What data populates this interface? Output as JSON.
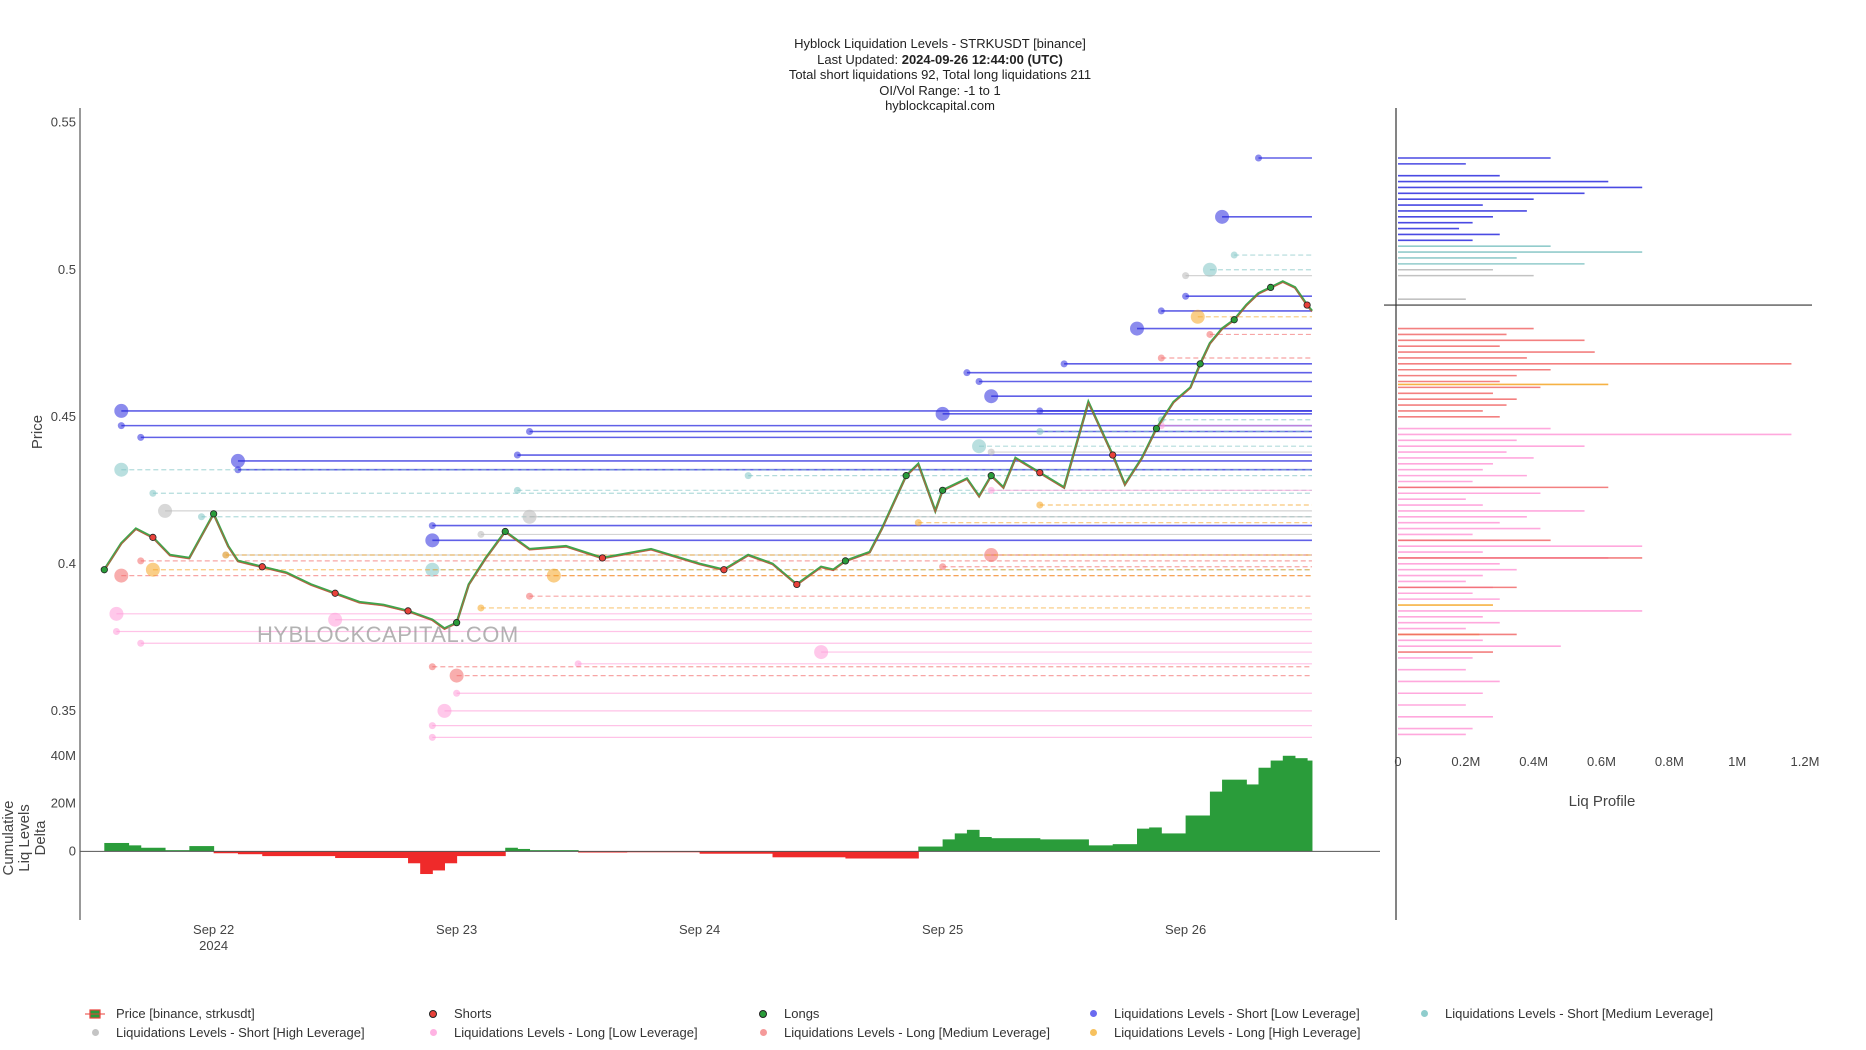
{
  "title": {
    "line1": "Hyblock Liquidation Levels - STRKUSDT [binance]",
    "line2_label": "Last Updated:",
    "line2_value": "2024-09-26 12:44:00 (UTC)",
    "line3": "Total short liquidations 92, Total long liquidations 211",
    "line4": "OI/Vol Range: -1 to 1",
    "line5": "hyblockcapital.com"
  },
  "watermark": "HYBLOCKCAPITAL.COM",
  "colors": {
    "price_up": "#2a9c3a",
    "price_down": "#e8413a",
    "short_low": "#2b2bdf",
    "short_medium": "#7fc4c4",
    "short_high": "#b8b8b8",
    "long_low": "#ff9ad8",
    "long_medium": "#f26a6a",
    "long_high": "#f5a524",
    "delta_pos": "#2a9c3a",
    "delta_neg": "#ef2a2a",
    "axis": "#333333"
  },
  "chart_data": [
    {
      "type": "line",
      "panel": "price",
      "ylabel": "Price",
      "ylim": [
        0.335,
        0.555
      ],
      "yticks": [
        "0.55",
        "0.5",
        "0.45",
        "0.4",
        "0.35"
      ],
      "ytick_values": [
        0.55,
        0.5,
        0.45,
        0.4,
        0.35
      ],
      "xticks": [
        "Sep 22\n2024",
        "Sep 23",
        "Sep 24",
        "Sep 25",
        "Sep 26"
      ],
      "xtick_days": [
        22,
        23,
        24,
        25,
        26
      ],
      "xrange_days": [
        21.45,
        26.8
      ],
      "series": [
        {
          "name": "Price [binance, strkusdt]",
          "x_days": [
            21.55,
            21.62,
            21.68,
            21.75,
            21.82,
            21.9,
            22.0,
            22.06,
            22.1,
            22.2,
            22.3,
            22.4,
            22.5,
            22.6,
            22.7,
            22.8,
            22.9,
            22.95,
            23.0,
            23.05,
            23.12,
            23.2,
            23.3,
            23.45,
            23.6,
            23.8,
            24.0,
            24.1,
            24.2,
            24.3,
            24.4,
            24.5,
            24.55,
            24.6,
            24.7,
            24.75,
            24.85,
            24.9,
            24.97,
            25.0,
            25.1,
            25.15,
            25.2,
            25.25,
            25.3,
            25.4,
            25.5,
            25.6,
            25.7,
            25.75,
            25.82,
            25.88,
            25.95,
            26.02,
            26.06,
            26.1,
            26.15,
            26.2,
            26.25,
            26.3,
            26.35,
            26.4,
            26.45,
            26.5,
            26.52
          ],
          "values": [
            0.398,
            0.407,
            0.412,
            0.409,
            0.403,
            0.402,
            0.417,
            0.406,
            0.401,
            0.399,
            0.397,
            0.393,
            0.39,
            0.387,
            0.386,
            0.384,
            0.381,
            0.378,
            0.38,
            0.393,
            0.402,
            0.411,
            0.405,
            0.406,
            0.402,
            0.405,
            0.4,
            0.398,
            0.403,
            0.4,
            0.393,
            0.399,
            0.398,
            0.401,
            0.404,
            0.412,
            0.43,
            0.434,
            0.418,
            0.425,
            0.429,
            0.423,
            0.43,
            0.426,
            0.436,
            0.431,
            0.426,
            0.455,
            0.437,
            0.427,
            0.436,
            0.446,
            0.455,
            0.46,
            0.468,
            0.475,
            0.48,
            0.483,
            0.488,
            0.492,
            0.494,
            0.496,
            0.494,
            0.488,
            0.486
          ]
        }
      ]
    },
    {
      "type": "bar",
      "panel": "liq-levels",
      "series": [
        {
          "name": "Liquidations Levels - Short [Low Leverage]",
          "start_days": [
            21.62,
            21.62,
            21.7,
            22.1,
            22.1,
            22.9,
            22.9,
            23.25,
            23.3,
            25.0,
            25.1,
            25.15,
            25.2,
            25.4,
            25.5,
            25.8,
            25.9,
            26.0,
            26.15,
            26.3
          ],
          "values": [
            0.452,
            0.447,
            0.443,
            0.435,
            0.432,
            0.413,
            0.408,
            0.437,
            0.445,
            0.451,
            0.465,
            0.462,
            0.457,
            0.452,
            0.468,
            0.48,
            0.486,
            0.491,
            0.518,
            0.538
          ]
        },
        {
          "name": "Liquidations Levels - Short [Medium Leverage]",
          "start_days": [
            21.62,
            21.75,
            21.95,
            22.9,
            23.25,
            24.2,
            25.15,
            25.4,
            25.9,
            26.1,
            26.2
          ],
          "values": [
            0.432,
            0.424,
            0.416,
            0.398,
            0.425,
            0.43,
            0.44,
            0.445,
            0.449,
            0.5,
            0.505
          ]
        },
        {
          "name": "Liquidations Levels - Short [High Leverage]",
          "start_days": [
            21.8,
            22.05,
            23.1,
            23.3,
            25.2,
            26.0
          ],
          "values": [
            0.418,
            0.403,
            0.41,
            0.416,
            0.438,
            0.498
          ]
        },
        {
          "name": "Liquidations Levels - Long [Low Leverage]",
          "start_days": [
            21.6,
            21.6,
            21.7,
            22.5,
            22.9,
            22.9,
            22.95,
            23.0,
            23.5,
            24.5,
            25.2,
            25.9
          ],
          "values": [
            0.383,
            0.377,
            0.373,
            0.381,
            0.341,
            0.345,
            0.35,
            0.356,
            0.366,
            0.37,
            0.425,
            0.447
          ]
        },
        {
          "name": "Liquidations Levels - Long [Medium Leverage]",
          "start_days": [
            21.62,
            21.7,
            22.9,
            23.0,
            23.3,
            25.0,
            25.2,
            25.9,
            26.1
          ],
          "values": [
            0.396,
            0.401,
            0.365,
            0.362,
            0.389,
            0.399,
            0.403,
            0.47,
            0.478
          ]
        },
        {
          "name": "Liquidations Levels - Long [High Leverage]",
          "start_days": [
            21.75,
            22.05,
            23.1,
            23.4,
            24.9,
            25.4,
            26.05
          ],
          "values": [
            0.398,
            0.403,
            0.385,
            0.396,
            0.414,
            0.42,
            0.484
          ]
        }
      ]
    },
    {
      "type": "area",
      "panel": "delta",
      "ylabel": "Cumulative Liq Levels Delta",
      "ylim": [
        -12,
        42
      ],
      "yticks": [
        "40M",
        "20M",
        "0"
      ],
      "ytick_values": [
        40,
        20,
        0
      ],
      "x_days": [
        21.55,
        21.65,
        21.7,
        21.8,
        21.9,
        22.0,
        22.1,
        22.2,
        22.5,
        22.8,
        22.85,
        22.9,
        22.95,
        23.0,
        23.2,
        23.25,
        23.3,
        23.5,
        23.7,
        24.0,
        24.3,
        24.6,
        24.9,
        25.0,
        25.05,
        25.1,
        25.15,
        25.2,
        25.4,
        25.6,
        25.7,
        25.8,
        25.85,
        25.9,
        26.0,
        26.1,
        26.15,
        26.25,
        26.3,
        26.35,
        26.4,
        26.45,
        26.5,
        26.52
      ],
      "values": [
        0,
        3.5,
        2.5,
        1.5,
        0.5,
        2.2,
        -0.8,
        -1.2,
        -2.0,
        -2.8,
        -5.0,
        -9.5,
        -8.0,
        -5.0,
        -2.0,
        1.5,
        1.0,
        0.5,
        -0.5,
        -0.4,
        -1.0,
        -2.5,
        -3.0,
        2.0,
        5.0,
        7.5,
        9.0,
        6.0,
        5.5,
        5.0,
        2.5,
        3.0,
        9.5,
        10.0,
        7.5,
        15.0,
        25.0,
        30.0,
        28.0,
        35.0,
        38.0,
        40.0,
        39.0,
        38.0
      ]
    },
    {
      "type": "bar",
      "panel": "liq-profile",
      "xlabel": "Liq Profile",
      "xlim": [
        0,
        1.2
      ],
      "xticks": [
        "0",
        "0.2M",
        "0.4M",
        "0.6M",
        "0.8M",
        "1M",
        "1.2M"
      ],
      "xtick_values": [
        0,
        0.2,
        0.4,
        0.6,
        0.8,
        1.0,
        1.2
      ],
      "current_price": 0.488,
      "series": [
        {
          "name": "short-low",
          "price": [
            0.538,
            0.536,
            0.532,
            0.53,
            0.528,
            0.526,
            0.524,
            0.522,
            0.52,
            0.518,
            0.516,
            0.514,
            0.512,
            0.51
          ],
          "values": [
            0.45,
            0.2,
            0.3,
            0.62,
            0.72,
            0.55,
            0.4,
            0.25,
            0.38,
            0.28,
            0.22,
            0.18,
            0.3,
            0.22
          ]
        },
        {
          "name": "short-medium",
          "price": [
            0.508,
            0.506,
            0.504,
            0.502
          ],
          "values": [
            0.45,
            0.72,
            0.35,
            0.55
          ]
        },
        {
          "name": "short-high",
          "price": [
            0.5,
            0.498,
            0.49
          ],
          "values": [
            0.28,
            0.4,
            0.2
          ]
        },
        {
          "name": "long-medium",
          "price": [
            0.48,
            0.478,
            0.476,
            0.474,
            0.472,
            0.47,
            0.468,
            0.466,
            0.464,
            0.462,
            0.46,
            0.458,
            0.456,
            0.454,
            0.452,
            0.45
          ],
          "values": [
            0.4,
            0.32,
            0.55,
            0.3,
            0.58,
            0.38,
            1.16,
            0.45,
            0.35,
            0.3,
            0.42,
            0.28,
            0.35,
            0.32,
            0.25,
            0.3
          ]
        },
        {
          "name": "long-high",
          "price": [
            0.461,
            0.386,
            0.376
          ],
          "values": [
            0.62,
            0.28,
            0.24
          ]
        },
        {
          "name": "long-low",
          "price": [
            0.446,
            0.444,
            0.442,
            0.44,
            0.438,
            0.436,
            0.434,
            0.432,
            0.43,
            0.428,
            0.426,
            0.424,
            0.422,
            0.42,
            0.418,
            0.416,
            0.414,
            0.412,
            0.41,
            0.408,
            0.406,
            0.404,
            0.402,
            0.4,
            0.398,
            0.396,
            0.394,
            0.392,
            0.39,
            0.388,
            0.384,
            0.382,
            0.38,
            0.378,
            0.374,
            0.372,
            0.368,
            0.364,
            0.36,
            0.356,
            0.352,
            0.348,
            0.344,
            0.342
          ],
          "values": [
            0.45,
            1.16,
            0.35,
            0.55,
            0.32,
            0.4,
            0.28,
            0.25,
            0.38,
            0.22,
            0.3,
            0.42,
            0.2,
            0.25,
            0.55,
            0.38,
            0.3,
            0.42,
            0.22,
            0.3,
            0.72,
            0.25,
            0.62,
            0.3,
            0.35,
            0.25,
            0.2,
            0.28,
            0.22,
            0.3,
            0.72,
            0.25,
            0.3,
            0.2,
            0.25,
            0.48,
            0.22,
            0.2,
            0.3,
            0.25,
            0.2,
            0.28,
            0.22,
            0.2
          ]
        },
        {
          "name": "long-medium-lower",
          "price": [
            0.426,
            0.408,
            0.402,
            0.392,
            0.376,
            0.37
          ],
          "values": [
            0.62,
            0.45,
            0.72,
            0.35,
            0.35,
            0.28
          ]
        }
      ]
    }
  ],
  "legend": [
    {
      "label": "Price [binance, strkusdt]",
      "kind": "candle"
    },
    {
      "label": "Shorts",
      "kind": "dot-outlined",
      "color": "#e8413a"
    },
    {
      "label": "Longs",
      "kind": "dot-outlined",
      "color": "#2a9c3a"
    },
    {
      "label": "Liquidations Levels - Short [Low Leverage]",
      "kind": "dot",
      "color": "#6a6af0"
    },
    {
      "label": "Liquidations Levels - Short [Medium Leverage]",
      "kind": "dot",
      "color": "#8fcdcd"
    },
    {
      "label": "Liquidations Levels - Short [High Leverage]",
      "kind": "dot",
      "color": "#c4c4c4"
    },
    {
      "label": "Liquidations Levels - Long [Low Leverage]",
      "kind": "dot",
      "color": "#ffb3e3"
    },
    {
      "label": "Liquidations Levels - Long [Medium Leverage]",
      "kind": "dot",
      "color": "#f59a9a"
    },
    {
      "label": "Liquidations Levels - Long [High Leverage]",
      "kind": "dot",
      "color": "#f7c15e"
    }
  ]
}
